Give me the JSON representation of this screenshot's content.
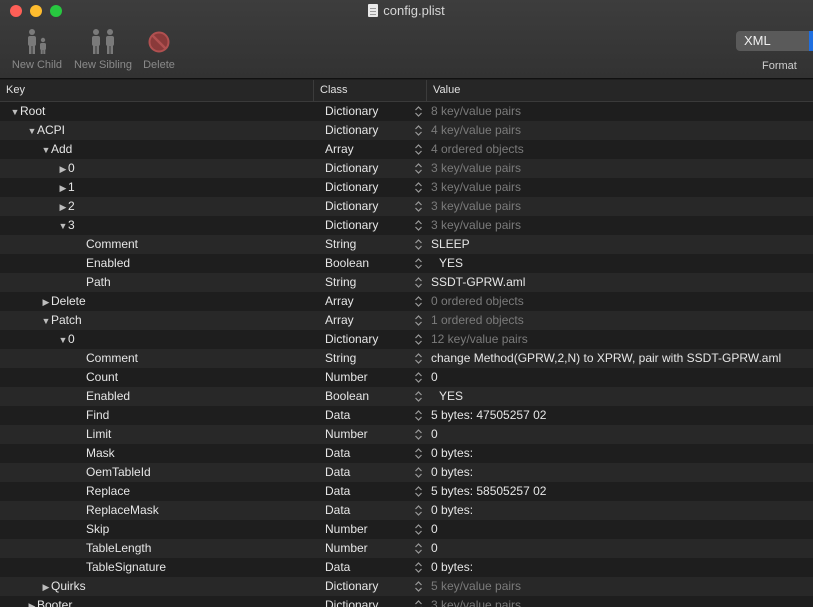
{
  "window": {
    "title": "config.plist"
  },
  "toolbar": {
    "new_child": "New Child",
    "new_sibling": "New Sibling",
    "delete": "Delete",
    "format_value": "XML",
    "format_label": "Format"
  },
  "columns": {
    "key": "Key",
    "class": "Class",
    "value": "Value"
  },
  "rows": [
    {
      "key": "Root",
      "depth": 0,
      "tri": "down",
      "class": "Dictionary",
      "value": "8 key/value pairs",
      "dim": true
    },
    {
      "key": "ACPI",
      "depth": 1,
      "tri": "down",
      "class": "Dictionary",
      "value": "4 key/value pairs",
      "dim": true
    },
    {
      "key": "Add",
      "depth": 2,
      "tri": "down",
      "class": "Array",
      "value": "4 ordered objects",
      "dim": true
    },
    {
      "key": "0",
      "depth": 3,
      "tri": "right",
      "class": "Dictionary",
      "value": "3 key/value pairs",
      "dim": true
    },
    {
      "key": "1",
      "depth": 3,
      "tri": "right",
      "class": "Dictionary",
      "value": "3 key/value pairs",
      "dim": true
    },
    {
      "key": "2",
      "depth": 3,
      "tri": "right",
      "class": "Dictionary",
      "value": "3 key/value pairs",
      "dim": true
    },
    {
      "key": "3",
      "depth": 3,
      "tri": "down",
      "class": "Dictionary",
      "value": "3 key/value pairs",
      "dim": true
    },
    {
      "key": "Comment",
      "depth": 4,
      "tri": "",
      "class": "String",
      "value": "SLEEP",
      "dim": false
    },
    {
      "key": "Enabled",
      "depth": 4,
      "tri": "",
      "class": "Boolean",
      "value": "YES",
      "dim": false,
      "bool": true
    },
    {
      "key": "Path",
      "depth": 4,
      "tri": "",
      "class": "String",
      "value": "SSDT-GPRW.aml",
      "dim": false
    },
    {
      "key": "Delete",
      "depth": 2,
      "tri": "right",
      "class": "Array",
      "value": "0 ordered objects",
      "dim": true
    },
    {
      "key": "Patch",
      "depth": 2,
      "tri": "down",
      "class": "Array",
      "value": "1 ordered objects",
      "dim": true
    },
    {
      "key": "0",
      "depth": 3,
      "tri": "down",
      "class": "Dictionary",
      "value": "12 key/value pairs",
      "dim": true
    },
    {
      "key": "Comment",
      "depth": 4,
      "tri": "",
      "class": "String",
      "value": "change Method(GPRW,2,N) to XPRW, pair with SSDT-GPRW.aml",
      "dim": false
    },
    {
      "key": "Count",
      "depth": 4,
      "tri": "",
      "class": "Number",
      "value": "0",
      "dim": false
    },
    {
      "key": "Enabled",
      "depth": 4,
      "tri": "",
      "class": "Boolean",
      "value": "YES",
      "dim": false,
      "bool": true
    },
    {
      "key": "Find",
      "depth": 4,
      "tri": "",
      "class": "Data",
      "value": "5 bytes: 47505257 02",
      "dim": false
    },
    {
      "key": "Limit",
      "depth": 4,
      "tri": "",
      "class": "Number",
      "value": "0",
      "dim": false
    },
    {
      "key": "Mask",
      "depth": 4,
      "tri": "",
      "class": "Data",
      "value": "0 bytes:",
      "dim": false
    },
    {
      "key": "OemTableId",
      "depth": 4,
      "tri": "",
      "class": "Data",
      "value": "0 bytes:",
      "dim": false
    },
    {
      "key": "Replace",
      "depth": 4,
      "tri": "",
      "class": "Data",
      "value": "5 bytes: 58505257 02",
      "dim": false
    },
    {
      "key": "ReplaceMask",
      "depth": 4,
      "tri": "",
      "class": "Data",
      "value": "0 bytes:",
      "dim": false
    },
    {
      "key": "Skip",
      "depth": 4,
      "tri": "",
      "class": "Number",
      "value": "0",
      "dim": false
    },
    {
      "key": "TableLength",
      "depth": 4,
      "tri": "",
      "class": "Number",
      "value": "0",
      "dim": false
    },
    {
      "key": "TableSignature",
      "depth": 4,
      "tri": "",
      "class": "Data",
      "value": "0 bytes:",
      "dim": false
    },
    {
      "key": "Quirks",
      "depth": 2,
      "tri": "right",
      "class": "Dictionary",
      "value": "5 key/value pairs",
      "dim": true
    },
    {
      "key": "Booter",
      "depth": 1,
      "tri": "right",
      "class": "Dictionary",
      "value": "3 key/value pairs",
      "dim": true
    }
  ]
}
